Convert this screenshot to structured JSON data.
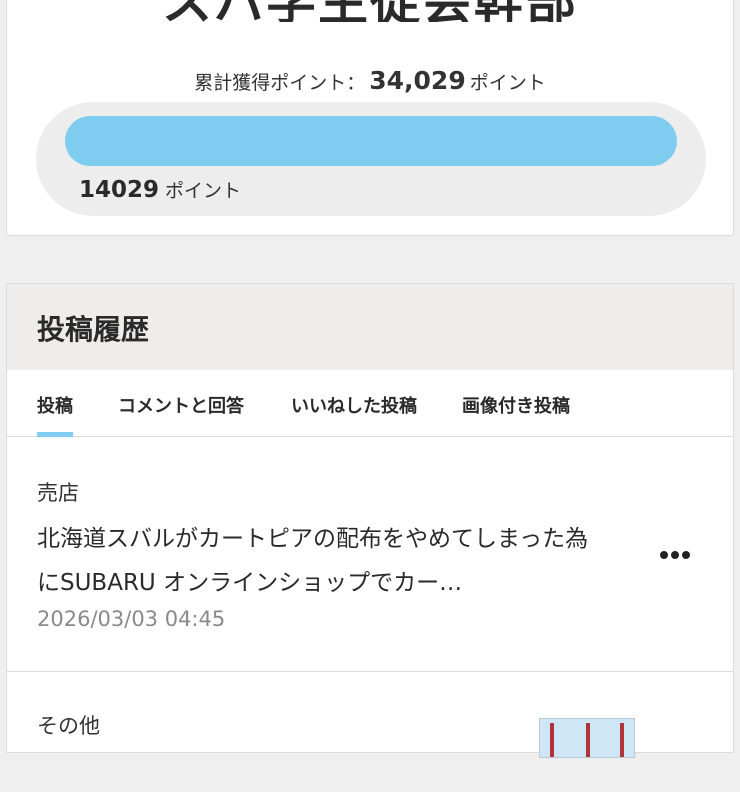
{
  "profile": {
    "rank_title": "スバ学生徒会幹部",
    "total_label": "累計獲得ポイント：",
    "total_points": "34,029",
    "total_unit": "ポイント",
    "current_points": "14029",
    "current_unit": "ポイント",
    "progress_fraction": 1.0,
    "progress_color": "#7ecdf0"
  },
  "history": {
    "title": "投稿履歴",
    "tabs": [
      {
        "label": "投稿",
        "active": true
      },
      {
        "label": "コメントと回答",
        "active": false
      },
      {
        "label": "いいねした投稿",
        "active": false
      },
      {
        "label": "画像付き投稿",
        "active": false
      }
    ],
    "posts": [
      {
        "category": "売店",
        "body": "北海道スバルがカートピアの配布をやめてしまった為にSUBARU オンラインショップでカー…",
        "date": "2026/03/03 04:45",
        "menu_icon": "more-horizontal-icon"
      },
      {
        "category": "その他",
        "thumbnail": "post-thumbnail"
      }
    ]
  }
}
